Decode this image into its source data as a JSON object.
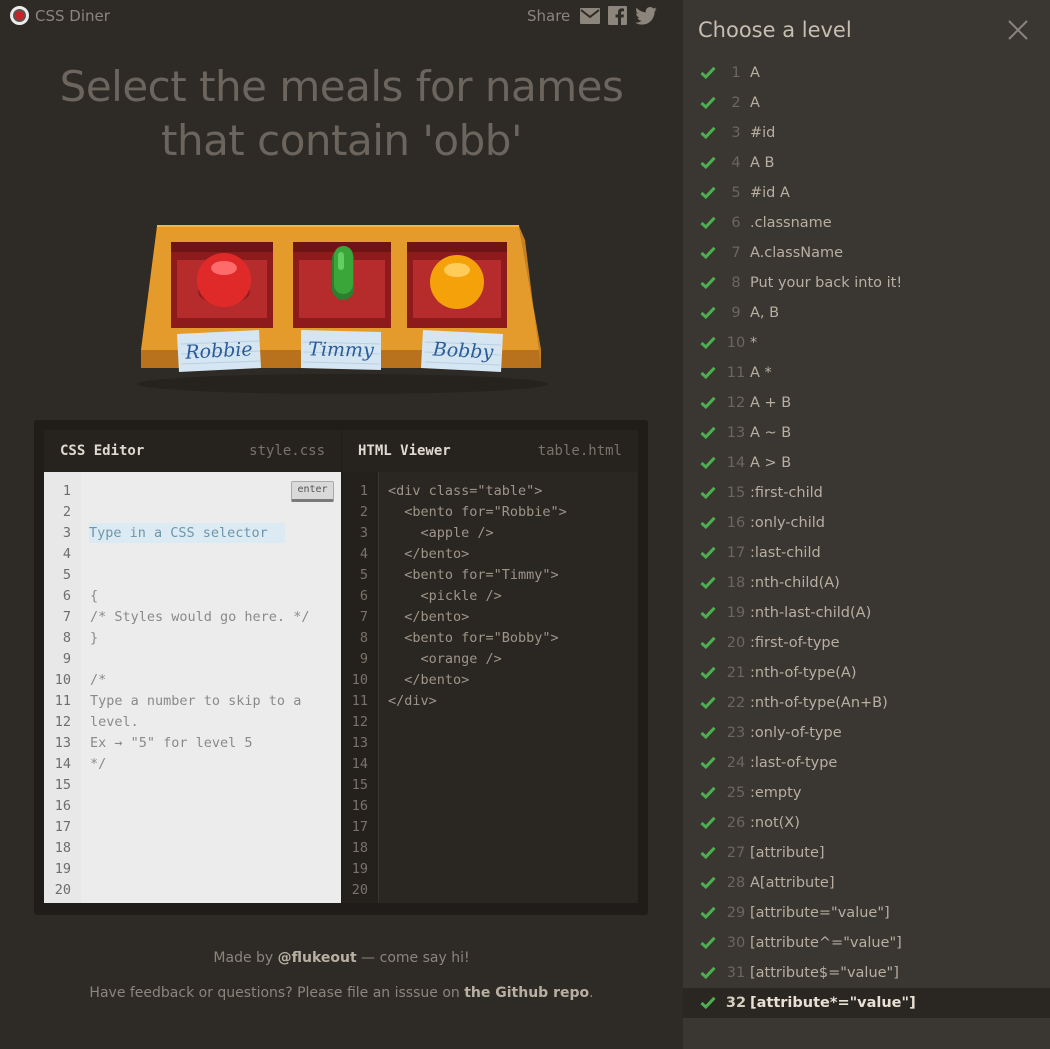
{
  "app": {
    "name": "CSS Diner"
  },
  "share": {
    "label": "Share",
    "icons": [
      "envelope-icon",
      "facebook-icon",
      "twitter-icon"
    ]
  },
  "instruction": {
    "line1": "Select the meals for names",
    "line2": "that contain 'obb'"
  },
  "table": {
    "bentos": [
      {
        "name": "Robbie",
        "item": "apple",
        "color": "#e02a2a"
      },
      {
        "name": "Timmy",
        "item": "pickle",
        "color": "#3aa63a"
      },
      {
        "name": "Bobby",
        "item": "orange",
        "color": "#f5a10a"
      }
    ]
  },
  "css_editor": {
    "title": "CSS Editor",
    "filename": "style.css",
    "placeholder": "Type in a CSS selector",
    "enter_label": "enter",
    "lines": [
      "{",
      "/* Styles would go here. */",
      "}",
      "",
      "/*",
      "Type a number to skip to a",
      "level.",
      "Ex → \"5\" for level 5",
      "*/"
    ],
    "line_numbers": [
      "1",
      "2",
      "3",
      "4",
      "5",
      "6",
      "7",
      "8",
      "9",
      "10",
      "11",
      "12",
      "13",
      "14",
      "15",
      "16",
      "17",
      "18",
      "19",
      "20"
    ]
  },
  "html_viewer": {
    "title": "HTML Viewer",
    "filename": "table.html",
    "lines": [
      "<div class=\"table\">",
      "  <bento for=\"Robbie\">",
      "    <apple />",
      "  </bento>",
      "  <bento for=\"Timmy\">",
      "    <pickle />",
      "  </bento>",
      "  <bento for=\"Bobby\">",
      "    <orange />",
      "  </bento>",
      "</div>"
    ],
    "line_numbers": [
      "1",
      "2",
      "3",
      "4",
      "5",
      "6",
      "7",
      "8",
      "9",
      "10",
      "11",
      "12",
      "13",
      "14",
      "15",
      "16",
      "17",
      "18",
      "19",
      "20"
    ]
  },
  "footer": {
    "made_by_prefix": "Made by ",
    "made_by_handle": "@flukeout",
    "made_by_suffix": " — come say hi!",
    "feedback_prefix": "Have feedback or questions? Please file an isssue on ",
    "feedback_link": "the Github repo",
    "feedback_suffix": "."
  },
  "sidebar": {
    "title": "Choose a level",
    "current_level": 32,
    "check_color": "#4caf50",
    "levels": [
      {
        "num": "1",
        "name": "A"
      },
      {
        "num": "2",
        "name": "A"
      },
      {
        "num": "3",
        "name": "#id"
      },
      {
        "num": "4",
        "name": "A  B"
      },
      {
        "num": "5",
        "name": "#id  A"
      },
      {
        "num": "6",
        "name": ".classname"
      },
      {
        "num": "7",
        "name": "A.className"
      },
      {
        "num": "8",
        "name": "Put your back into it!"
      },
      {
        "num": "9",
        "name": "A, B"
      },
      {
        "num": "10",
        "name": "*"
      },
      {
        "num": "11",
        "name": "A  *"
      },
      {
        "num": "12",
        "name": "A + B"
      },
      {
        "num": "13",
        "name": "A ~ B"
      },
      {
        "num": "14",
        "name": "A > B"
      },
      {
        "num": "15",
        "name": ":first-child"
      },
      {
        "num": "16",
        "name": ":only-child"
      },
      {
        "num": "17",
        "name": ":last-child"
      },
      {
        "num": "18",
        "name": ":nth-child(A)"
      },
      {
        "num": "19",
        "name": ":nth-last-child(A)"
      },
      {
        "num": "20",
        "name": ":first-of-type"
      },
      {
        "num": "21",
        "name": ":nth-of-type(A)"
      },
      {
        "num": "22",
        "name": ":nth-of-type(An+B)"
      },
      {
        "num": "23",
        "name": ":only-of-type"
      },
      {
        "num": "24",
        "name": ":last-of-type"
      },
      {
        "num": "25",
        "name": ":empty"
      },
      {
        "num": "26",
        "name": ":not(X)"
      },
      {
        "num": "27",
        "name": "[attribute]"
      },
      {
        "num": "28",
        "name": "A[attribute]"
      },
      {
        "num": "29",
        "name": "[attribute=\"value\"]"
      },
      {
        "num": "30",
        "name": "[attribute^=\"value\"]"
      },
      {
        "num": "31",
        "name": "[attribute$=\"value\"]"
      },
      {
        "num": "32",
        "name": "[attribute*=\"value\"]"
      }
    ]
  }
}
